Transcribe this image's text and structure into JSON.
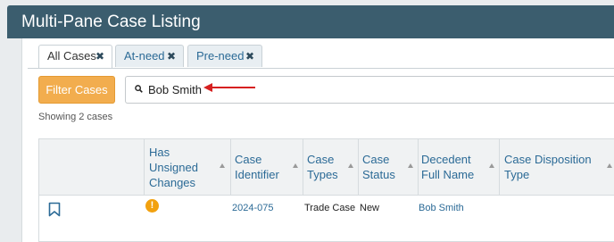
{
  "header": {
    "title": "Multi-Pane Case Listing"
  },
  "tabs": [
    {
      "label": "All Cases",
      "active": true
    },
    {
      "label": "At-need",
      "active": false
    },
    {
      "label": "Pre-need",
      "active": false
    }
  ],
  "toolbar": {
    "filter_label": "Filter Cases",
    "search_value": "Bob Smith",
    "search_icon": "search-icon"
  },
  "results": {
    "showing": "Showing 2 cases"
  },
  "table": {
    "columns": [
      {
        "label": ""
      },
      {
        "label": "Has Unsigned Changes"
      },
      {
        "label": "Case Identifier"
      },
      {
        "label": "Case Types"
      },
      {
        "label": "Case Status"
      },
      {
        "label": "Decedent Full Name"
      },
      {
        "label": "Case Disposition Type"
      }
    ],
    "rows": [
      {
        "bookmark_icon": "bookmark-icon",
        "unsigned_icon": "warning-icon",
        "case_identifier": "2024-075",
        "case_types": "Trade Case",
        "case_status": "New",
        "decedent": "Bob Smith",
        "disposition": ""
      }
    ]
  },
  "colors": {
    "header_bg": "#3b5d6e",
    "filter_btn": "#f2ad4e",
    "link": "#2b6a96",
    "annotation": "#d62020",
    "warning": "#f2a10f"
  }
}
